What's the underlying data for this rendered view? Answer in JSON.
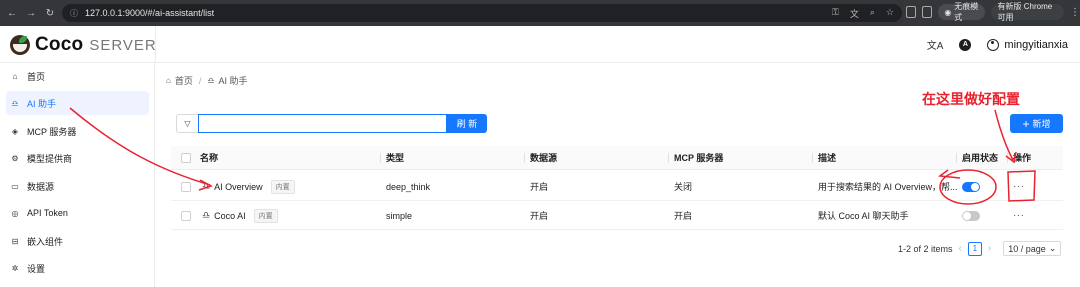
{
  "browser": {
    "url": "127.0.0.1:9000/#/ai-assistant/list",
    "incognito_label": "无痕模式",
    "update_label": "有新版 Chrome 可用"
  },
  "header": {
    "logo_text": "Coco",
    "logo_sub": "SERVER",
    "username": "mingyitianxia"
  },
  "sidebar": {
    "items": [
      {
        "label": "首页",
        "icon": "home-icon"
      },
      {
        "label": "AI 助手",
        "icon": "robot-icon",
        "active": true
      },
      {
        "label": "MCP 服务器",
        "icon": "mcp-icon"
      },
      {
        "label": "模型提供商",
        "icon": "provider-icon"
      },
      {
        "label": "数据源",
        "icon": "folder-icon"
      },
      {
        "label": "API Token",
        "icon": "key-icon"
      },
      {
        "label": "嵌入组件",
        "icon": "embed-icon"
      },
      {
        "label": "设置",
        "icon": "gear-icon"
      }
    ]
  },
  "breadcrumb": {
    "home": "首页",
    "current": "AI 助手"
  },
  "toolbar": {
    "search_value": "",
    "refresh_label": "刷 新",
    "new_label": "新增"
  },
  "table": {
    "columns": [
      "名称",
      "类型",
      "数据源",
      "MCP 服务器",
      "描述",
      "启用状态",
      "操作"
    ],
    "rows": [
      {
        "name": "AI Overview",
        "tag": "内置",
        "type": "deep_think",
        "datasource": "开启",
        "mcp": "关闭",
        "description": "用于搜索结果的 AI Overview，帮...",
        "enabled": true,
        "action": "···"
      },
      {
        "name": "Coco AI",
        "tag": "内置",
        "type": "simple",
        "datasource": "开启",
        "mcp": "开启",
        "description": "默认 Coco AI 聊天助手",
        "enabled": false,
        "action": "···"
      }
    ]
  },
  "pagination": {
    "summary": "1-2 of 2 items",
    "current_page": "1",
    "page_size": "10 / page"
  },
  "annotation": {
    "text": "在这里做好配置",
    "color": "#e8232f"
  }
}
